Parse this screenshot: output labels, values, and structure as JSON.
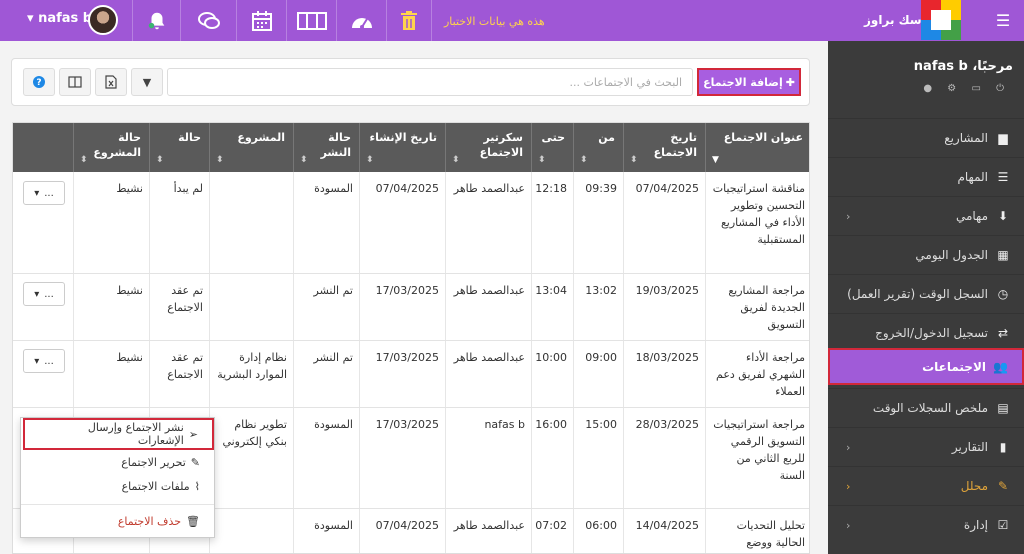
{
  "topbar": {
    "user_name": "nafas b",
    "notice": "هذه هي بيانات الاختبار",
    "brand": "تاسك براوز",
    "icons": [
      "chevron-down-icon",
      "notification-bell-icon",
      "chat-icon",
      "calendar-icon",
      "columns-icon",
      "dashboard-icon",
      "trash-icon",
      "menu-icon"
    ]
  },
  "sidebar": {
    "greeting": "مرحبًا، nafas b",
    "mini_icons": "⏻ ▭ ⚙ ●",
    "items": [
      {
        "label": "المشاريع",
        "icon": "briefcase-icon"
      },
      {
        "label": "المهام",
        "icon": "list-icon"
      },
      {
        "label": "مهامي",
        "icon": "download-icon"
      },
      {
        "label": "الجدول اليومي",
        "icon": "grid-icon"
      },
      {
        "label": "السجل الوقت (تقرير العمل)",
        "icon": "clock-icon"
      },
      {
        "label": "تسجيل الدخول/الخروج",
        "icon": "exchange-icon"
      },
      {
        "label": "الاجتماعات",
        "icon": "users-icon"
      },
      {
        "label": "ملخص السجلات الوقت",
        "icon": "summary-icon"
      },
      {
        "label": "التقارير",
        "icon": "file-icon"
      },
      {
        "label": "محلل",
        "icon": "magic-icon"
      },
      {
        "label": "إدارة",
        "icon": "check-icon"
      }
    ]
  },
  "toolbar": {
    "add_label": "إضافة الاجتماع",
    "search_placeholder": "البحث في الاجتماعات ..."
  },
  "table": {
    "headers": [
      "عنوان الاجتماع",
      "تاريخ الاجتماع",
      "من",
      "حتى",
      "سكرتير الاجتماع",
      "تاريخ الإنشاء",
      "حالة النشر",
      "المشروع",
      "حالة",
      "حالة المشروع"
    ],
    "rows": [
      {
        "title": "مناقشة استراتيجيات التحسين وتطوير الأداء في المشاريع المستقبلية",
        "date": "07/04/2025",
        "from": "09:39",
        "to": "12:18",
        "secretary": "عبدالصمد طاهر",
        "created": "07/04/2025",
        "publish": "المسودة",
        "project": "",
        "status": "لم يبدأ",
        "project_status": "نشيط"
      },
      {
        "title": "مراجعة المشاريع الجديدة لفريق التسويق",
        "date": "19/03/2025",
        "from": "13:02",
        "to": "13:04",
        "secretary": "عبدالصمد طاهر",
        "created": "17/03/2025",
        "publish": "تم النشر",
        "project": "",
        "status": "تم عقد الاجتماع",
        "project_status": "نشيط"
      },
      {
        "title": "مراجعة الأداء الشهري لفريق دعم العملاء",
        "date": "18/03/2025",
        "from": "09:00",
        "to": "10:00",
        "secretary": "عبدالصمد طاهر",
        "created": "17/03/2025",
        "publish": "تم النشر",
        "project": "نظام إدارة الموارد البشرية",
        "status": "تم عقد الاجتماع",
        "project_status": "نشيط"
      },
      {
        "title": "مراجعة استراتيجيات التسويق الرقمي للربع الثاني من السنة",
        "date": "28/03/2025",
        "from": "15:00",
        "to": "16:00",
        "secretary": "nafas b",
        "created": "17/03/2025",
        "publish": "المسودة",
        "project": "تطوير نظام بنكي إلكتروني",
        "status": "",
        "project_status": ""
      },
      {
        "title": "تحليل التحديات الحالية ووضع",
        "date": "14/04/2025",
        "from": "06:00",
        "to": "07:02",
        "secretary": "عبدالصمد طاهر",
        "created": "07/04/2025",
        "publish": "المسودة",
        "project": "",
        "status": "",
        "project_status": ""
      }
    ],
    "action_label": "..."
  },
  "menu": {
    "items": [
      "نشر الاجتماع وإرسال الإشعارات",
      "تحرير الاجتماع",
      "ملفات الاجتماع",
      "حذف الاجتماع"
    ]
  },
  "colors": {
    "primary": "#9f57d6",
    "sidebar_bg": "#3b3b3b",
    "highlight": "#d2283a",
    "table_header": "#5a5a5a"
  }
}
